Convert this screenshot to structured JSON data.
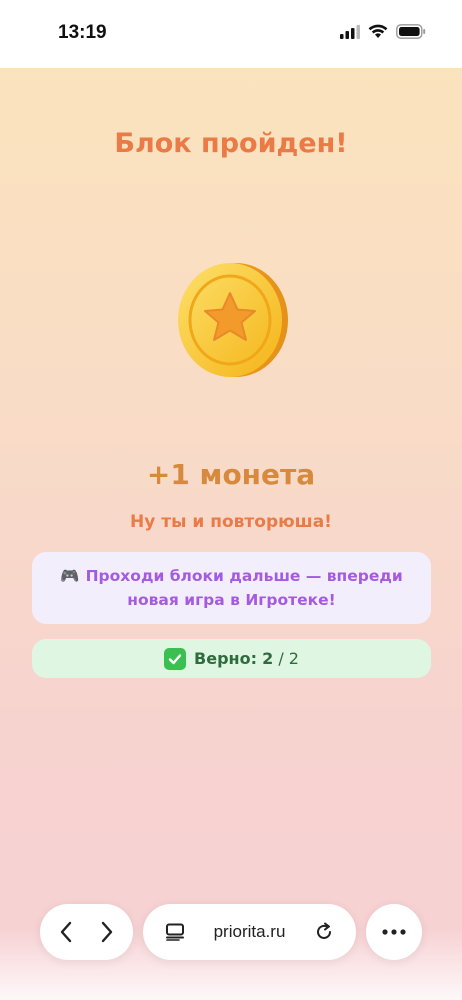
{
  "status_bar": {
    "time": "13:19",
    "icons": [
      "signal-icon",
      "wifi-icon",
      "battery-icon"
    ]
  },
  "main": {
    "title": "Блок пройден!",
    "coin_icon": "star-coin-icon",
    "reward": "+1 монета",
    "subtitle": "Ну ты и повторюша!",
    "promo": {
      "icon": "🎮",
      "text": "Проходи блоки дальше — впереди новая игра в Игротеке!"
    },
    "score": {
      "label": "Верно:",
      "correct": "2",
      "total": "/ 2"
    }
  },
  "browser_bar": {
    "url": "priorita.ru"
  },
  "colors": {
    "title": "#ea7a46",
    "reward": "#d78a3d",
    "promo_text": "#a45be0",
    "promo_bg": "#f3eefc",
    "score_bg": "#dff6e3",
    "coin": "#f6bf2a"
  }
}
